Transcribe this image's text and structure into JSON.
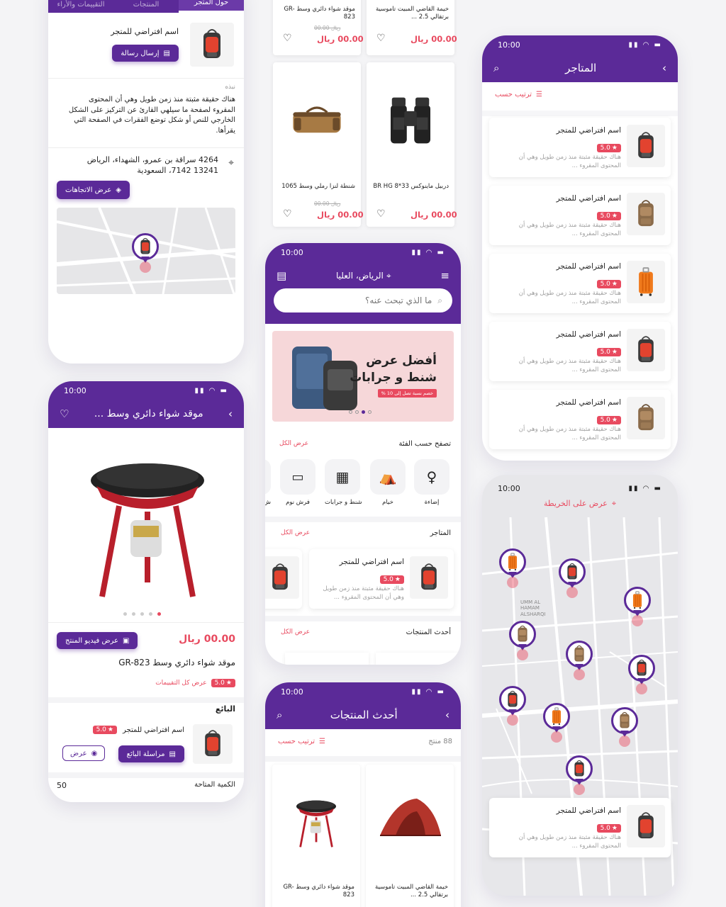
{
  "colors": {
    "primary": "#5b2a98",
    "accent": "#e84a5f",
    "background": "#f4f4f6"
  },
  "status_time": "10:00",
  "store_details": {
    "tabs": [
      "حول المتجر",
      "المنتجات",
      "التقييمات والأراء"
    ],
    "store_name": "اسم افتراضي للمتجر",
    "send_message": "إرسال رسالة",
    "about_label": "نبذه",
    "about_text": "هناك حقيقة مثبتة منذ زمن طويل وهي أن المحتوى المقروء لصفحة ما سيلهي القارئ عن التركيز على الشكل الخارجي للنص أو شكل توضع الفقرات في الصفحة التي يقرأها.",
    "address": "4264 سراقة بن عمرو، الشهداء، الرياض 13241 7142، السعودية",
    "directions": "عرض الاتجاهات"
  },
  "product_grid_top": {
    "items": [
      {
        "name": "موقد شواء دائري وسط GR-823",
        "old_price": "00.00 ريال",
        "price": "00.00 ريال"
      },
      {
        "name": "خيمة القاضي المبيت تاموسية برتقالي 2.5 ...",
        "old_price": "",
        "price": "00.00 ريال"
      },
      {
        "name": "شنطة لنزا رملي وسط 1065",
        "old_price": "00.00 ريال",
        "price": "00.00 ريال"
      },
      {
        "name": "دربيل ماينوكس 33*8 BR HG",
        "old_price": "",
        "price": "00.00 ريال"
      }
    ]
  },
  "stores_list": {
    "title": "المتاجر",
    "sort": "ترتيب حسب",
    "cards": [
      {
        "name": "اسم افتراضي للمتجر",
        "rating": "5.0",
        "desc": "هناك حقيقة مثبتة منذ زمن طويل وهي أن المحتوى المقروء ..."
      },
      {
        "name": "اسم افتراضي للمتجر",
        "rating": "5.0",
        "desc": "هناك حقيقة مثبتة منذ زمن طويل وهي أن المحتوى المقروء ..."
      },
      {
        "name": "اسم افتراضي للمتجر",
        "rating": "5.0",
        "desc": "هناك حقيقة مثبتة منذ زمن طويل وهي أن المحتوى المقروء ..."
      },
      {
        "name": "اسم افتراضي للمتجر",
        "rating": "5.0",
        "desc": "هناك حقيقة مثبتة منذ زمن طويل وهي أن المحتوى المقروء ..."
      },
      {
        "name": "اسم افتراضي للمتجر",
        "rating": "5.0",
        "desc": "هناك حقيقة مثبتة منذ زمن طويل وهي أن المحتوى المقروء ..."
      }
    ]
  },
  "home": {
    "location": "الرياض، العليا",
    "search_placeholder": "ما الذي تبحث عنه؟",
    "banner_title_1": "أفضل عرض",
    "banner_title_2": "شنط و جرابات",
    "banner_badge": "خصم نسبة تصل إلى 10 %",
    "browse_category": "تصفح حسب الفئة",
    "view_all": "عرض الكل",
    "categories": [
      "إضاءة",
      "خيام",
      "شنط و جرابات",
      "فرش نوم",
      "ش"
    ],
    "stores_title": "المتاجر",
    "store_card": {
      "name": "اسم افتراضي للمتجر",
      "rating": "5.0",
      "desc": "هناك حقيقة مثبتة منذ زمن طويل وهي أن المحتوى المقروء ..."
    },
    "latest_products": "أحدث المنتجات"
  },
  "product_detail": {
    "title": "موقد شواء دائري وسط ...",
    "price": "00.00 ريال",
    "video_button": "عرض فيديو المنتج",
    "full_name": "موقد شواء دائري وسط GR-823",
    "rating": "5.0",
    "all_reviews": "عرض كل التقييمات",
    "seller_label": "البائع",
    "seller_name": "اسم افتراضي للمتجر",
    "message_seller": "مراسلة البائع",
    "view": "عرض",
    "qty_label": "الكمية المتاحة",
    "qty_value": "50"
  },
  "latest_products": {
    "title": "أحدث المنتجات",
    "count": "88 منتج",
    "sort": "ترتيب حسب",
    "items": [
      {
        "name": "خيمة القاضي المبيت تاموسية برتقالي 2.5 ..."
      },
      {
        "name": "موقد شواء دائري وسط GR-823"
      }
    ]
  },
  "map_view": {
    "show_on_map": "عرض على الخريطة",
    "map_labels": [
      "UMM AL HAMAM ALSHARQI"
    ],
    "card": {
      "name": "اسم افتراضي للمتجر",
      "rating": "5.0",
      "desc": "هناك حقيقة مثبتة منذ زمن طويل وهي أن المحتوى المقروء ..."
    }
  }
}
